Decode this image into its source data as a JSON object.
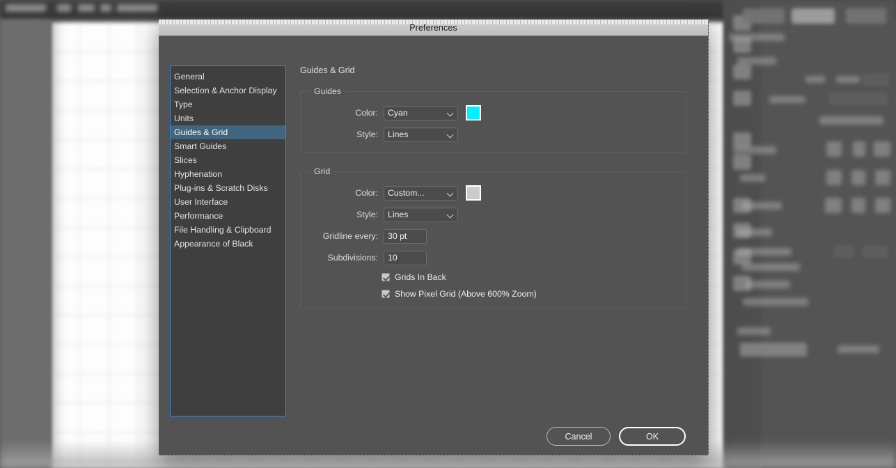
{
  "background": {
    "description": "blurred Adobe Illustrator workspace behind modal"
  },
  "dialog": {
    "title": "Preferences",
    "section_heading": "Guides & Grid",
    "sidebar": {
      "items": [
        {
          "label": "General",
          "selected": false
        },
        {
          "label": "Selection & Anchor Display",
          "selected": false
        },
        {
          "label": "Type",
          "selected": false
        },
        {
          "label": "Units",
          "selected": false
        },
        {
          "label": "Guides & Grid",
          "selected": true
        },
        {
          "label": "Smart Guides",
          "selected": false
        },
        {
          "label": "Slices",
          "selected": false
        },
        {
          "label": "Hyphenation",
          "selected": false
        },
        {
          "label": "Plug-ins & Scratch Disks",
          "selected": false
        },
        {
          "label": "User Interface",
          "selected": false
        },
        {
          "label": "Performance",
          "selected": false
        },
        {
          "label": "File Handling & Clipboard",
          "selected": false
        },
        {
          "label": "Appearance of Black",
          "selected": false
        }
      ]
    },
    "guides_group": {
      "legend": "Guides",
      "color_label": "Color:",
      "color_value": "Cyan",
      "color_swatch": "#00f0ff",
      "style_label": "Style:",
      "style_value": "Lines"
    },
    "grid_group": {
      "legend": "Grid",
      "color_label": "Color:",
      "color_value": "Custom...",
      "color_swatch": "#cbcbcb",
      "style_label": "Style:",
      "style_value": "Lines",
      "gridline_label": "Gridline every:",
      "gridline_value": "30 pt",
      "subdivisions_label": "Subdivisions:",
      "subdivisions_value": "10",
      "grids_in_back_label": "Grids In Back",
      "grids_in_back_checked": true,
      "show_pixel_grid_label": "Show Pixel Grid (Above 600% Zoom)",
      "show_pixel_grid_checked": true
    },
    "footer": {
      "cancel_label": "Cancel",
      "ok_label": "OK"
    }
  }
}
